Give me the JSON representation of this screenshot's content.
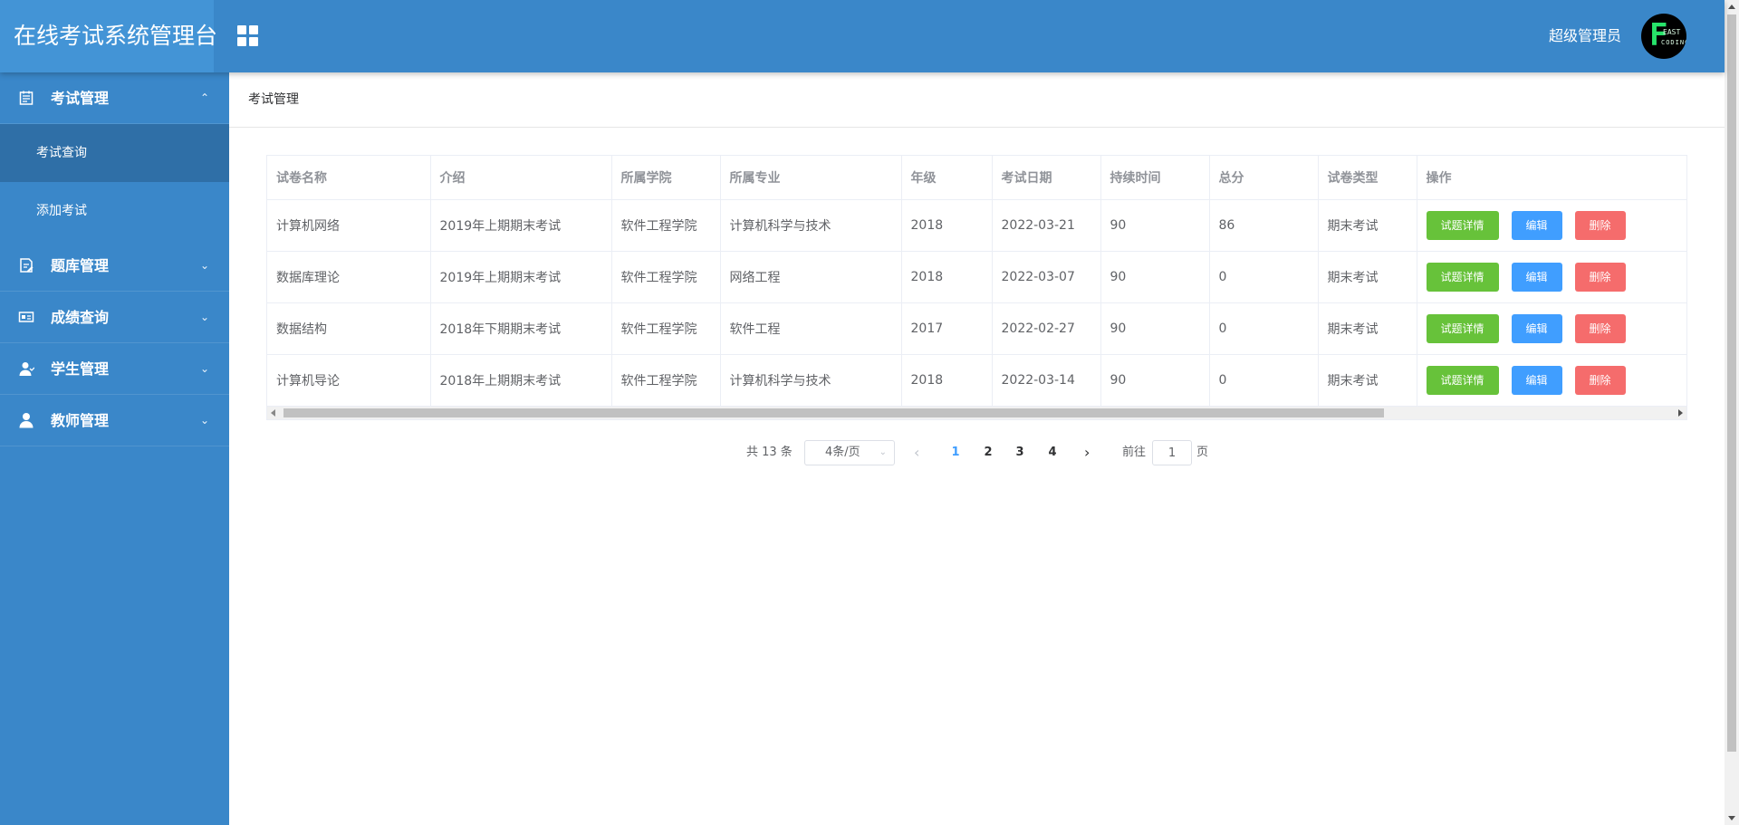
{
  "app": {
    "title": "在线考试系统管理台",
    "user_name": "超级管理员",
    "avatar": {
      "big_letter": "F",
      "line1": "EAST",
      "line2": "CODING"
    }
  },
  "sidebar": {
    "groups": [
      {
        "label": "考试管理",
        "icon": "calendar-icon",
        "chevron": "⌃",
        "items": [
          {
            "label": "考试查询",
            "active": true
          },
          {
            "label": "添加考试",
            "active": false
          }
        ]
      },
      {
        "label": "题库管理",
        "icon": "edit-doc-icon",
        "chevron": "⌄"
      },
      {
        "label": "成绩查询",
        "icon": "id-card-icon",
        "chevron": "⌄"
      },
      {
        "label": "学生管理",
        "icon": "user-icon",
        "chevron": "⌄"
      },
      {
        "label": "教师管理",
        "icon": "person-icon",
        "chevron": "⌄"
      }
    ]
  },
  "breadcrumb": "考试管理",
  "table": {
    "headers": [
      "试卷名称",
      "介绍",
      "所属学院",
      "所属专业",
      "年级",
      "考试日期",
      "持续时间",
      "总分",
      "试卷类型",
      "操作"
    ],
    "rows": [
      [
        "计算机网络",
        "2019年上期期末考试",
        "软件工程学院",
        "计算机科学与技术",
        "2018",
        "2022-03-21",
        "90",
        "86",
        "期末考试"
      ],
      [
        "数据库理论",
        "2019年上期期末考试",
        "软件工程学院",
        "网络工程",
        "2018",
        "2022-03-07",
        "90",
        "0",
        "期末考试"
      ],
      [
        "数据结构",
        "2018年下期期末考试",
        "软件工程学院",
        "软件工程",
        "2017",
        "2022-02-27",
        "90",
        "0",
        "期末考试"
      ],
      [
        "计算机导论",
        "2018年上期期末考试",
        "软件工程学院",
        "计算机科学与技术",
        "2018",
        "2022-03-14",
        "90",
        "0",
        "期末考试"
      ]
    ],
    "actions": {
      "detail": "试题详情",
      "edit": "编辑",
      "delete": "删除"
    }
  },
  "pagination": {
    "total_text": "共 13 条",
    "page_size": "4条/页",
    "pages": [
      "1",
      "2",
      "3",
      "4"
    ],
    "current_page": "1",
    "goto_label": "前往",
    "goto_value": "1",
    "page_suffix": "页"
  },
  "colors": {
    "header_bg": "#3a87c9",
    "brand_bg": "#4394d6",
    "active_menu_bg": "#2f6fa7",
    "success": "#67c23a",
    "primary": "#409eff",
    "danger": "#f56c6c"
  }
}
